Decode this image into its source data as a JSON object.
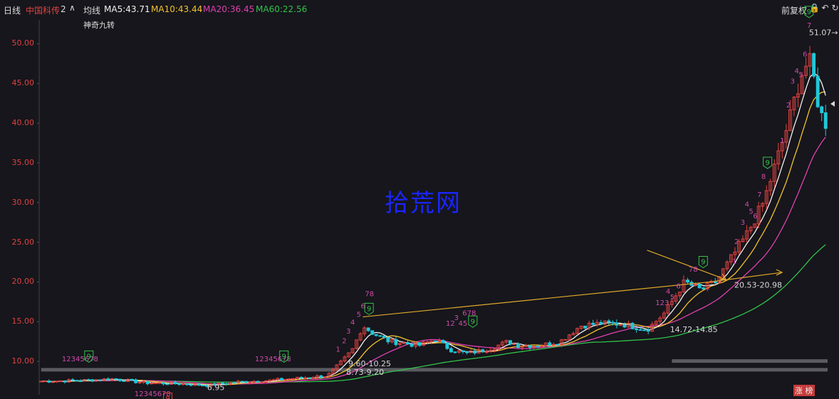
{
  "header": {
    "period": "日线",
    "stock_name": "中国科传",
    "indicator_count": "2",
    "ma_label": "均线",
    "ma5": "MA5:43.71",
    "ma10": "MA10:43.44",
    "ma20": "MA20:36.45",
    "ma60": "MA60:22.56",
    "adjust": "前复权",
    "indicator_name": "神奇九转",
    "colors": {
      "ma5": "#f2f2f2",
      "ma10": "#f3c12e",
      "ma20": "#e040b0",
      "ma60": "#33c24a",
      "up": "#e0423f",
      "down": "#20c8d8"
    }
  },
  "icons": [
    "chevron-up-icon",
    "lock-icon",
    "undo-icon",
    "refresh-icon"
  ],
  "watermark": "拾荒网",
  "badge_labels": [
    "涨",
    "榜"
  ],
  "chart_data": {
    "type": "candlestick",
    "yticks": [
      "50.00",
      "45.00",
      "40.00",
      "35.00",
      "30.00",
      "25.00",
      "20.00",
      "15.00",
      "10.00"
    ],
    "ylim": [
      5.8,
      53
    ],
    "n_bars": 200,
    "price_path": [
      [
        0,
        7.5
      ],
      [
        20,
        7.6
      ],
      [
        35,
        7.8
      ],
      [
        50,
        7.3
      ],
      [
        65,
        7.2
      ],
      [
        80,
        7.0
      ],
      [
        95,
        7.4
      ],
      [
        110,
        7.6
      ],
      [
        125,
        7.9
      ],
      [
        138,
        8.2
      ],
      [
        145,
        10.0
      ],
      [
        150,
        11.5
      ],
      [
        155,
        14.5
      ],
      [
        160,
        13.5
      ],
      [
        168,
        12.5
      ],
      [
        175,
        12.3
      ],
      [
        182,
        12.0
      ],
      [
        190,
        12.8
      ],
      [
        197,
        11.5
      ],
      [
        205,
        11.0
      ],
      [
        215,
        11.5
      ],
      [
        225,
        12.5
      ],
      [
        230,
        12.0
      ],
      [
        240,
        12.0
      ],
      [
        250,
        12.5
      ],
      [
        260,
        14.5
      ],
      [
        270,
        14.8
      ],
      [
        280,
        14.7
      ],
      [
        292,
        14.0
      ],
      [
        300,
        16.0
      ],
      [
        305,
        18.0
      ],
      [
        310,
        20.0
      ],
      [
        318,
        19.0
      ],
      [
        325,
        20.0
      ],
      [
        330,
        22.0
      ],
      [
        340,
        26.0
      ],
      [
        348,
        30.0
      ],
      [
        354,
        35.0
      ],
      [
        360,
        40.0
      ],
      [
        366,
        46.0
      ],
      [
        370,
        48.0
      ],
      [
        372,
        46.0
      ],
      [
        374,
        43.0
      ],
      [
        376,
        41.0
      ],
      [
        378,
        40.0
      ]
    ],
    "annotations": [
      {
        "text": "51.07→",
        "x": 370,
        "y": 51.07
      },
      {
        "text": "20.53-20.98",
        "x": 334,
        "y": 19.3
      },
      {
        "text": "14.72-14.85",
        "x": 303,
        "y": 13.7
      },
      {
        "text": "9.60-10.25",
        "x": 148,
        "y": 9.4
      },
      {
        "text": "8.73-9.20",
        "x": 147,
        "y": 8.3
      },
      {
        "text": "6.95",
        "x": 80,
        "y": 6.4
      }
    ],
    "support_bands": [
      {
        "x_start": 334,
        "y": 20.8
      },
      {
        "x_start": 160,
        "y": 10.0
      },
      {
        "x_start": 0,
        "y": 8.9
      },
      {
        "x_start": 300,
        "y": 14.8
      }
    ],
    "trend_lines": [
      {
        "from": [
          155,
          15.6
        ],
        "to": [
          322,
          20.0
        ]
      },
      {
        "from": [
          322,
          20.0
        ],
        "to": [
          357,
          21.2
        ]
      }
    ],
    "nine_turn_markers": [
      {
        "label": "9",
        "x": 23,
        "y": 10.6,
        "color": "#33c24a"
      },
      {
        "label": "9",
        "x": 117,
        "y": 10.6,
        "color": "#33c24a"
      },
      {
        "label": "9",
        "x": 61,
        "y": 5.3,
        "color": "#e0423f"
      },
      {
        "label": "9",
        "x": 158,
        "y": 16.6,
        "color": "#33c24a"
      },
      {
        "label": "9",
        "x": 208,
        "y": 15.0,
        "color": "#33c24a"
      },
      {
        "label": "9",
        "x": 319,
        "y": 22.5,
        "color": "#33c24a"
      },
      {
        "label": "9",
        "x": 350,
        "y": 35.0,
        "color": "#33c24a"
      },
      {
        "label": "9",
        "x": 370,
        "y": 54.0,
        "color": "#33c24a"
      }
    ],
    "count_labels": [
      {
        "text": "12345678",
        "x": 10,
        "y": 10.0
      },
      {
        "text": "12345678",
        "x": 103,
        "y": 10.0
      },
      {
        "text": "12345678",
        "x": 45,
        "y": 5.6
      },
      {
        "text": "1",
        "x": 142,
        "y": 11.2
      },
      {
        "text": "2",
        "x": 145,
        "y": 12.3
      },
      {
        "text": "3",
        "x": 147,
        "y": 13.5
      },
      {
        "text": "4",
        "x": 149,
        "y": 14.6
      },
      {
        "text": "5",
        "x": 152,
        "y": 15.6
      },
      {
        "text": "6",
        "x": 154,
        "y": 16.7
      },
      {
        "text": "78",
        "x": 156,
        "y": 18.2
      },
      {
        "text": "12",
        "x": 195,
        "y": 14.5
      },
      {
        "text": "3",
        "x": 199,
        "y": 15.2
      },
      {
        "text": "45",
        "x": 201,
        "y": 14.5
      },
      {
        "text": "678",
        "x": 203,
        "y": 15.8
      },
      {
        "text": "123",
        "x": 296,
        "y": 17.1
      },
      {
        "text": "4",
        "x": 301,
        "y": 18.5
      },
      {
        "text": "5",
        "x": 303,
        "y": 17.8
      },
      {
        "text": "6",
        "x": 306,
        "y": 19.2
      },
      {
        "text": "78",
        "x": 312,
        "y": 21.3
      },
      {
        "text": "1",
        "x": 333,
        "y": 22.3
      },
      {
        "text": "2",
        "x": 334,
        "y": 24.8
      },
      {
        "text": "3",
        "x": 337,
        "y": 27.2
      },
      {
        "text": "4",
        "x": 339,
        "y": 29.5
      },
      {
        "text": "5",
        "x": 341,
        "y": 28.6
      },
      {
        "text": "6",
        "x": 343,
        "y": 28.0
      },
      {
        "text": "7",
        "x": 345,
        "y": 30.7
      },
      {
        "text": "8",
        "x": 347,
        "y": 33.0
      },
      {
        "text": "1",
        "x": 356,
        "y": 37.5
      },
      {
        "text": "2",
        "x": 359,
        "y": 42.0
      },
      {
        "text": "3",
        "x": 361,
        "y": 45.0
      },
      {
        "text": "4",
        "x": 363,
        "y": 46.3
      },
      {
        "text": "5",
        "x": 365,
        "y": 45.8
      },
      {
        "text": "6",
        "x": 367,
        "y": 48.4
      },
      {
        "text": "7",
        "x": 369,
        "y": 52.0
      }
    ]
  }
}
